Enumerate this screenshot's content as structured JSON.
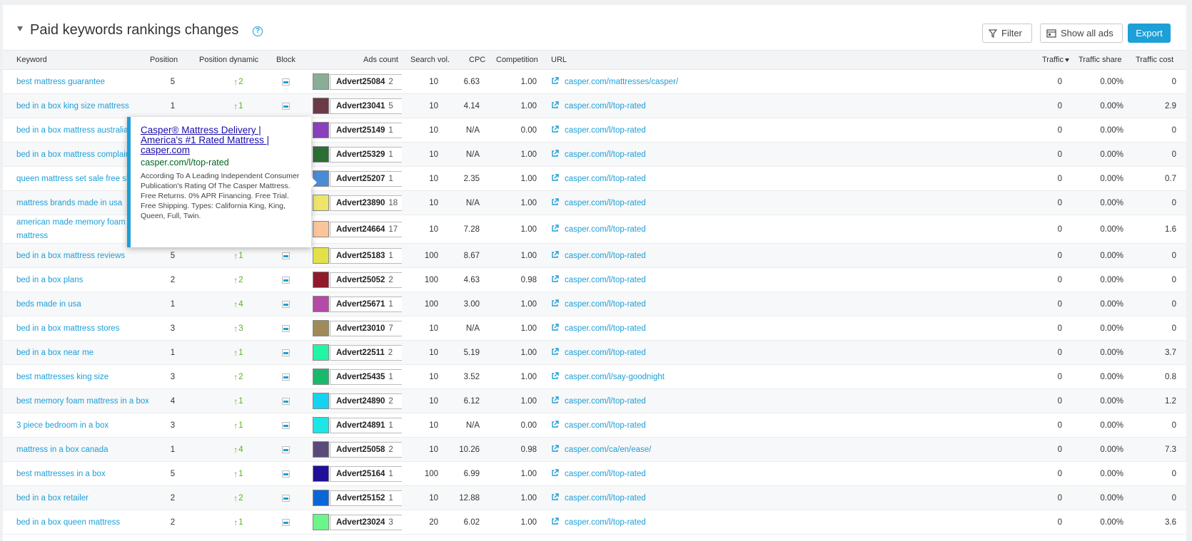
{
  "header": {
    "title": "Paid keywords rankings changes",
    "help_icon": "?",
    "filter_label": "Filter",
    "show_ads_label": "Show all ads",
    "export_label": "Export"
  },
  "columns": {
    "keyword": "Keyword",
    "position": "Position",
    "position_dynamic": "Position dynamic",
    "block": "Block",
    "ads_count": "Ads count",
    "search_vol": "Search vol.",
    "cpc": "CPC",
    "competition": "Competition",
    "url": "URL",
    "traffic": "Traffic",
    "traffic_share": "Traffic share",
    "traffic_cost": "Traffic cost"
  },
  "icons": {
    "dynamic_up": "arrow-up-icon",
    "block": "block-icon",
    "url": "external-link-icon"
  },
  "tooltip": {
    "title": "Casper® Mattress Delivery | America's #1 Rated Mattress | casper.com",
    "url": "casper.com/l/top-rated",
    "description": "According To A Leading Independent Consumer Publication's Rating Of The Casper Mattress. Free Returns. 0% APR Financing. Free Trial. Free Shipping. Types: California King, King, Queen, Full, Twin."
  },
  "rows": [
    {
      "keyword": "best mattress guarantee",
      "position": "5",
      "dynamic": "2",
      "color": "#8aad95",
      "advert": "Advert25084",
      "count": "2",
      "search_vol": "10",
      "cpc": "6.63",
      "competition": "1.00",
      "url": "casper.com/mattresses/casper/",
      "traffic": "0",
      "traffic_share": "0.00%",
      "traffic_cost": "0"
    },
    {
      "keyword": "bed in a box king size mattress",
      "position": "1",
      "dynamic": "1",
      "color": "#6b3a47",
      "advert": "Advert23041",
      "count": "5",
      "search_vol": "10",
      "cpc": "4.14",
      "competition": "1.00",
      "url": "casper.com/l/top-rated",
      "traffic": "0",
      "traffic_share": "0.00%",
      "traffic_cost": "2.9"
    },
    {
      "keyword": "bed in a box mattress australia",
      "position": "",
      "dynamic": "",
      "color": "#8b3fbd",
      "advert": "Advert25149",
      "count": "1",
      "search_vol": "10",
      "cpc": "N/A",
      "competition": "0.00",
      "url": "casper.com/l/top-rated",
      "traffic": "0",
      "traffic_share": "0.00%",
      "traffic_cost": "0"
    },
    {
      "keyword": "bed in a box mattress complaints",
      "position": "",
      "dynamic": "",
      "color": "#2b6e33",
      "advert": "Advert25329",
      "count": "1",
      "search_vol": "10",
      "cpc": "N/A",
      "competition": "1.00",
      "url": "casper.com/l/top-rated",
      "traffic": "0",
      "traffic_share": "0.00%",
      "traffic_cost": "0"
    },
    {
      "keyword": "queen mattress set sale free shipping",
      "position": "",
      "dynamic": "",
      "color": "#4a8bd6",
      "advert": "Advert25207",
      "count": "1",
      "search_vol": "10",
      "cpc": "2.35",
      "competition": "1.00",
      "url": "casper.com/l/top-rated",
      "traffic": "0",
      "traffic_share": "0.00%",
      "traffic_cost": "0.7"
    },
    {
      "keyword": "mattress brands made in usa",
      "position": "",
      "dynamic": "",
      "color": "#eee56a",
      "advert": "Advert23890",
      "count": "18",
      "search_vol": "10",
      "cpc": "N/A",
      "competition": "1.00",
      "url": "casper.com/l/top-rated",
      "traffic": "0",
      "traffic_share": "0.00%",
      "traffic_cost": "0"
    },
    {
      "keyword": "american made memory foam mattress",
      "position": "",
      "dynamic": "",
      "color": "#fbc49a",
      "advert": "Advert24664",
      "count": "17",
      "search_vol": "10",
      "cpc": "7.28",
      "competition": "1.00",
      "url": "casper.com/l/top-rated",
      "traffic": "0",
      "traffic_share": "0.00%",
      "traffic_cost": "1.6",
      "tall": true
    },
    {
      "keyword": "bed in a box mattress reviews",
      "position": "5",
      "dynamic": "1",
      "color": "#e3e04a",
      "advert": "Advert25183",
      "count": "1",
      "search_vol": "100",
      "cpc": "8.67",
      "competition": "1.00",
      "url": "casper.com/l/top-rated",
      "traffic": "0",
      "traffic_share": "0.00%",
      "traffic_cost": "0"
    },
    {
      "keyword": "bed in a box plans",
      "position": "2",
      "dynamic": "2",
      "color": "#8e1a2a",
      "advert": "Advert25052",
      "count": "2",
      "search_vol": "100",
      "cpc": "4.63",
      "competition": "0.98",
      "url": "casper.com/l/top-rated",
      "traffic": "0",
      "traffic_share": "0.00%",
      "traffic_cost": "0"
    },
    {
      "keyword": "beds made in usa",
      "position": "1",
      "dynamic": "4",
      "color": "#b44aa6",
      "advert": "Advert25671",
      "count": "1",
      "search_vol": "100",
      "cpc": "3.00",
      "competition": "1.00",
      "url": "casper.com/l/top-rated",
      "traffic": "0",
      "traffic_share": "0.00%",
      "traffic_cost": "0"
    },
    {
      "keyword": "bed in a box mattress stores",
      "position": "3",
      "dynamic": "3",
      "color": "#a08a5a",
      "advert": "Advert23010",
      "count": "7",
      "search_vol": "10",
      "cpc": "N/A",
      "competition": "1.00",
      "url": "casper.com/l/top-rated",
      "traffic": "0",
      "traffic_share": "0.00%",
      "traffic_cost": "0"
    },
    {
      "keyword": "bed in a box near me",
      "position": "1",
      "dynamic": "1",
      "color": "#22f5a6",
      "advert": "Advert22511",
      "count": "2",
      "search_vol": "10",
      "cpc": "5.19",
      "competition": "1.00",
      "url": "casper.com/l/top-rated",
      "traffic": "0",
      "traffic_share": "0.00%",
      "traffic_cost": "3.7"
    },
    {
      "keyword": "best mattresses king size",
      "position": "3",
      "dynamic": "2",
      "color": "#18b86d",
      "advert": "Advert25435",
      "count": "1",
      "search_vol": "10",
      "cpc": "3.52",
      "competition": "1.00",
      "url": "casper.com/l/say-goodnight",
      "traffic": "0",
      "traffic_share": "0.00%",
      "traffic_cost": "0.8"
    },
    {
      "keyword": "best memory foam mattress in a box",
      "position": "4",
      "dynamic": "1",
      "color": "#13d3f0",
      "advert": "Advert24890",
      "count": "2",
      "search_vol": "10",
      "cpc": "6.12",
      "competition": "1.00",
      "url": "casper.com/l/top-rated",
      "traffic": "0",
      "traffic_share": "0.00%",
      "traffic_cost": "1.2"
    },
    {
      "keyword": "3 piece bedroom in a box",
      "position": "3",
      "dynamic": "1",
      "color": "#1de6e6",
      "advert": "Advert24891",
      "count": "1",
      "search_vol": "10",
      "cpc": "N/A",
      "competition": "0.00",
      "url": "casper.com/l/top-rated",
      "traffic": "0",
      "traffic_share": "0.00%",
      "traffic_cost": "0"
    },
    {
      "keyword": "mattress in a box canada",
      "position": "1",
      "dynamic": "4",
      "color": "#5a4a7a",
      "advert": "Advert25058",
      "count": "2",
      "search_vol": "10",
      "cpc": "10.26",
      "competition": "0.98",
      "url": "casper.com/ca/en/ease/",
      "traffic": "0",
      "traffic_share": "0.00%",
      "traffic_cost": "7.3"
    },
    {
      "keyword": "best mattresses in a box",
      "position": "5",
      "dynamic": "1",
      "color": "#1f0f9a",
      "advert": "Advert25164",
      "count": "1",
      "search_vol": "100",
      "cpc": "6.99",
      "competition": "1.00",
      "url": "casper.com/l/top-rated",
      "traffic": "0",
      "traffic_share": "0.00%",
      "traffic_cost": "0"
    },
    {
      "keyword": "bed in a box retailer",
      "position": "2",
      "dynamic": "2",
      "color": "#0a66d6",
      "advert": "Advert25152",
      "count": "1",
      "search_vol": "10",
      "cpc": "12.88",
      "competition": "1.00",
      "url": "casper.com/l/top-rated",
      "traffic": "0",
      "traffic_share": "0.00%",
      "traffic_cost": "0"
    },
    {
      "keyword": "bed in a box queen mattress",
      "position": "2",
      "dynamic": "1",
      "color": "#6cf58a",
      "advert": "Advert23024",
      "count": "3",
      "search_vol": "20",
      "cpc": "6.02",
      "competition": "1.00",
      "url": "casper.com/l/top-rated",
      "traffic": "0",
      "traffic_share": "0.00%",
      "traffic_cost": "3.6"
    }
  ]
}
